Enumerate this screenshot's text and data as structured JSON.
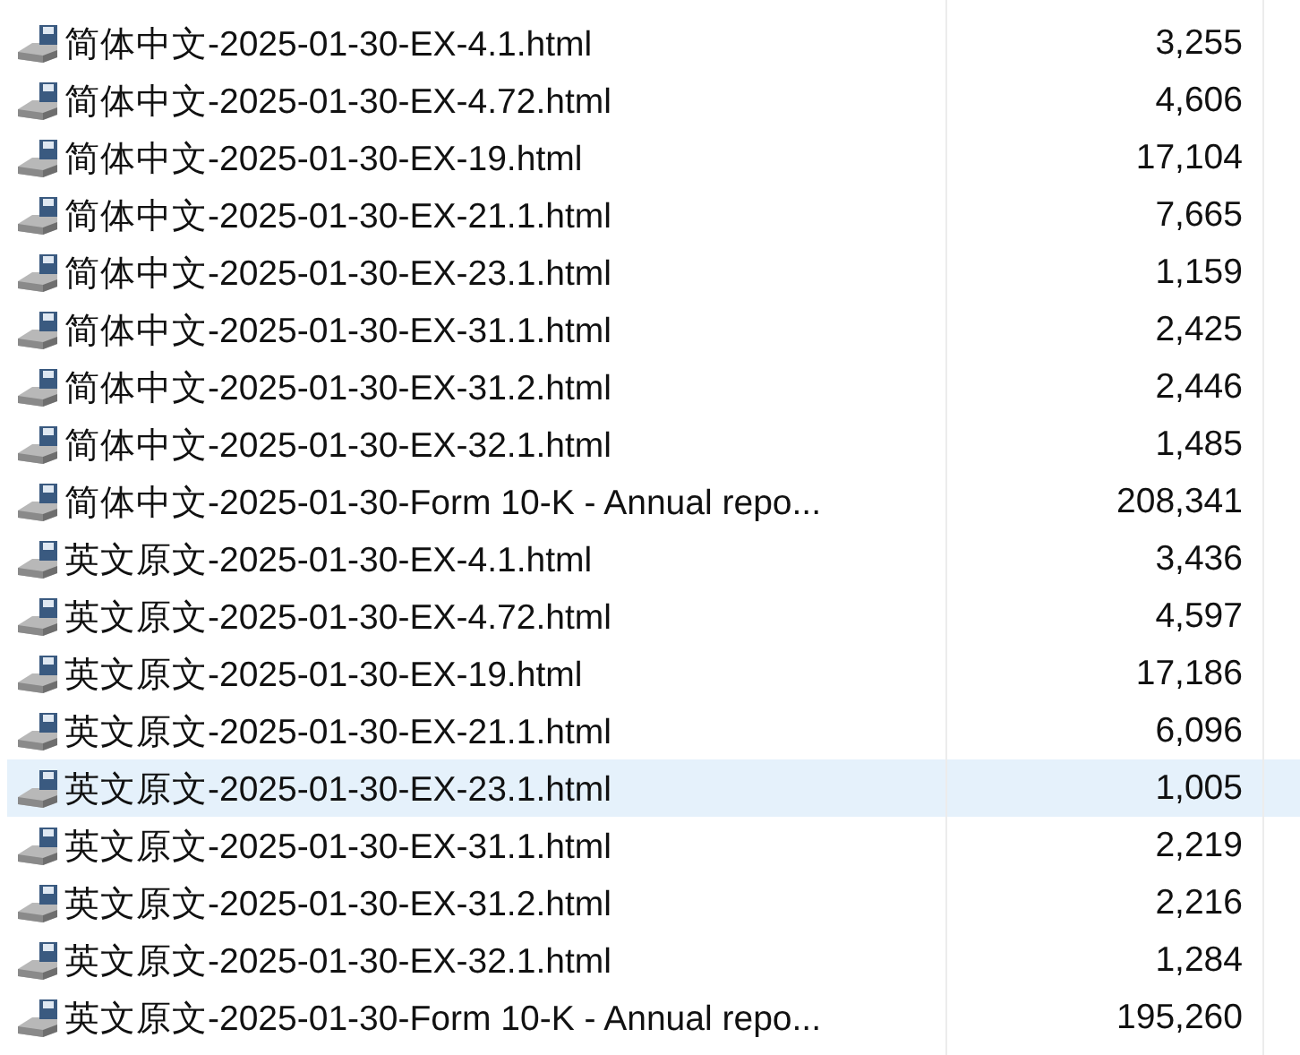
{
  "files": [
    {
      "name": "简体中文-2025-01-30-EX-4.1.html",
      "size": "3,255",
      "selected": false
    },
    {
      "name": "简体中文-2025-01-30-EX-4.72.html",
      "size": "4,606",
      "selected": false
    },
    {
      "name": "简体中文-2025-01-30-EX-19.html",
      "size": "17,104",
      "selected": false
    },
    {
      "name": "简体中文-2025-01-30-EX-21.1.html",
      "size": "7,665",
      "selected": false
    },
    {
      "name": "简体中文-2025-01-30-EX-23.1.html",
      "size": "1,159",
      "selected": false
    },
    {
      "name": "简体中文-2025-01-30-EX-31.1.html",
      "size": "2,425",
      "selected": false
    },
    {
      "name": "简体中文-2025-01-30-EX-31.2.html",
      "size": "2,446",
      "selected": false
    },
    {
      "name": "简体中文-2025-01-30-EX-32.1.html",
      "size": "1,485",
      "selected": false
    },
    {
      "name": "简体中文-2025-01-30-Form 10-K - Annual repo...",
      "size": "208,341",
      "selected": false
    },
    {
      "name": "英文原文-2025-01-30-EX-4.1.html",
      "size": "3,436",
      "selected": false
    },
    {
      "name": "英文原文-2025-01-30-EX-4.72.html",
      "size": "4,597",
      "selected": false
    },
    {
      "name": "英文原文-2025-01-30-EX-19.html",
      "size": "17,186",
      "selected": false
    },
    {
      "name": "英文原文-2025-01-30-EX-21.1.html",
      "size": "6,096",
      "selected": false
    },
    {
      "name": "英文原文-2025-01-30-EX-23.1.html",
      "size": "1,005",
      "selected": true
    },
    {
      "name": "英文原文-2025-01-30-EX-31.1.html",
      "size": "2,219",
      "selected": false
    },
    {
      "name": "英文原文-2025-01-30-EX-31.2.html",
      "size": "2,216",
      "selected": false
    },
    {
      "name": "英文原文-2025-01-30-EX-32.1.html",
      "size": "1,284",
      "selected": false
    },
    {
      "name": "英文原文-2025-01-30-Form 10-K - Annual repo...",
      "size": "195,260",
      "selected": false
    }
  ]
}
